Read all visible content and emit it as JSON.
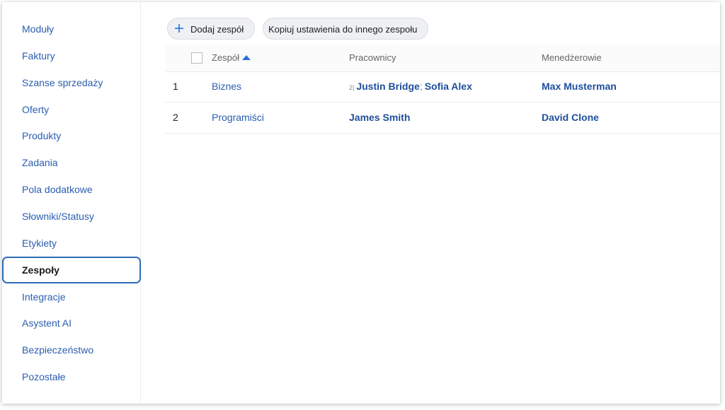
{
  "sidebar": {
    "items": [
      {
        "label": "Moduły"
      },
      {
        "label": "Faktury"
      },
      {
        "label": "Szanse sprzedaży"
      },
      {
        "label": "Oferty"
      },
      {
        "label": "Produkty"
      },
      {
        "label": "Zadania"
      },
      {
        "label": "Pola dodatkowe"
      },
      {
        "label": "Słowniki/Statusy"
      },
      {
        "label": "Etykiety"
      },
      {
        "label": "Zespoły",
        "active": true
      },
      {
        "label": "Integracje"
      },
      {
        "label": "Asystent AI"
      },
      {
        "label": "Bezpieczeństwo"
      },
      {
        "label": "Pozostałe"
      }
    ]
  },
  "toolbar": {
    "add_label": "Dodaj zespół",
    "copy_label": "Kopiuj ustawienia do innego zespołu"
  },
  "table": {
    "headers": {
      "team": "Zespół",
      "employees": "Pracownicy",
      "managers": "Menedżerowie"
    },
    "sort": "ascending",
    "rows": [
      {
        "index": "1",
        "team": "Biznes",
        "employee_count": "2|",
        "employees": [
          "Justin Bridge",
          "Sofia Alex"
        ],
        "manager": "Max Musterman"
      },
      {
        "index": "2",
        "team": "Programiści",
        "employee_count": "",
        "employees": [
          "James Smith"
        ],
        "manager": "David Clone"
      }
    ]
  },
  "colors": {
    "link": "#2a5db0",
    "accent": "#2a7de1",
    "active_border": "#2f6db5"
  }
}
